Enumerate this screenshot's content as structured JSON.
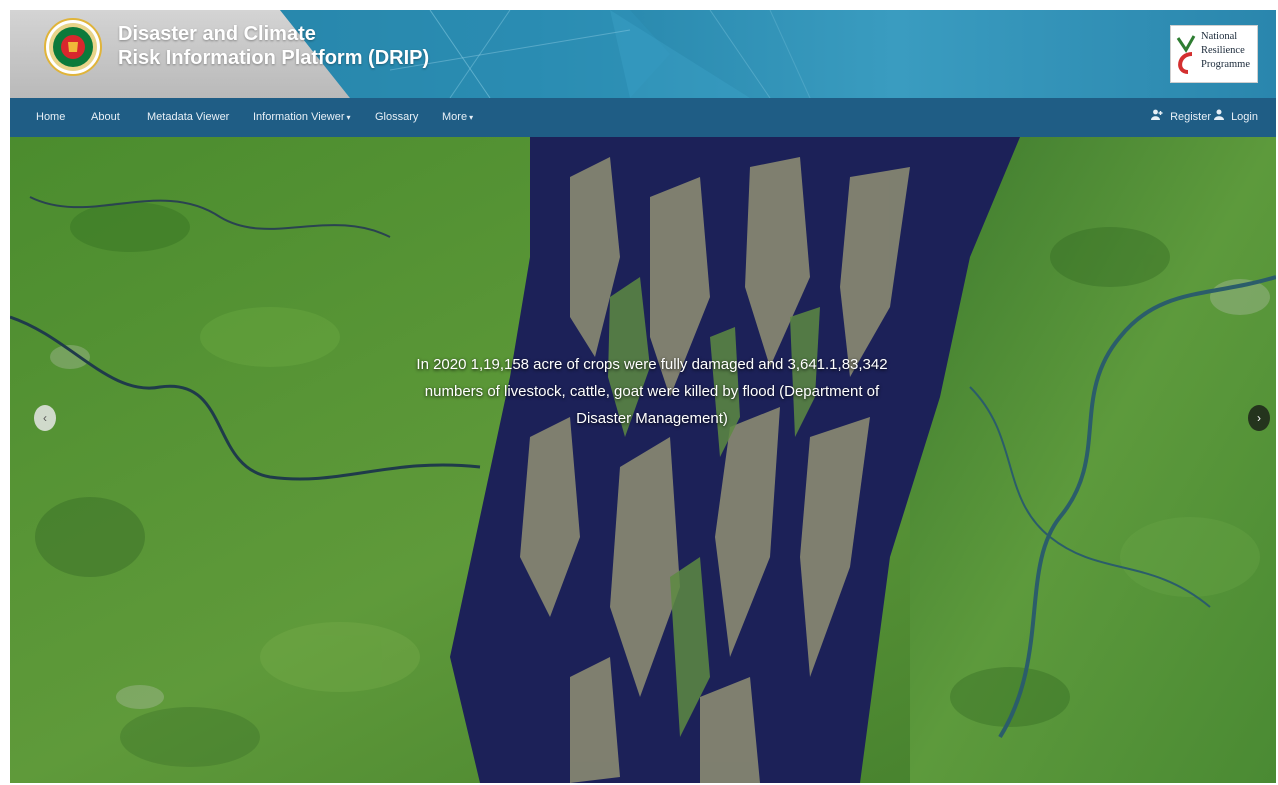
{
  "header": {
    "title_line1": "Disaster and Climate",
    "title_line2": "Risk Information Platform (DRIP)",
    "logo_left": "bangladesh-government-emblem",
    "partner_logo_text": [
      "National",
      "Resilience",
      "Programme"
    ]
  },
  "nav": {
    "items": [
      {
        "label": "Home"
      },
      {
        "label": "About"
      },
      {
        "label": "Metadata Viewer"
      },
      {
        "label": "Information Viewer",
        "dropdown": true
      },
      {
        "label": "Glossary"
      },
      {
        "label": "More",
        "dropdown": true
      }
    ],
    "register_label": "Register",
    "login_label": "Login",
    "caret": "▾",
    "register_icon": "add-user-icon",
    "login_icon": "user-icon"
  },
  "hero": {
    "caption_line1": "In 2020 1,19,158 acre of crops were fully damaged and 3,641.1,83,342",
    "caption_line2": "numbers of livestock, cattle, goat were killed by flood (Department of",
    "caption_line3": "Disaster Management)",
    "prev_glyph": "‹",
    "next_glyph": "›"
  },
  "colors": {
    "header_blue": "#2483a8",
    "nav_blue": "#1f5d85",
    "river": "#1a1f55",
    "land": "#4f8f33"
  }
}
